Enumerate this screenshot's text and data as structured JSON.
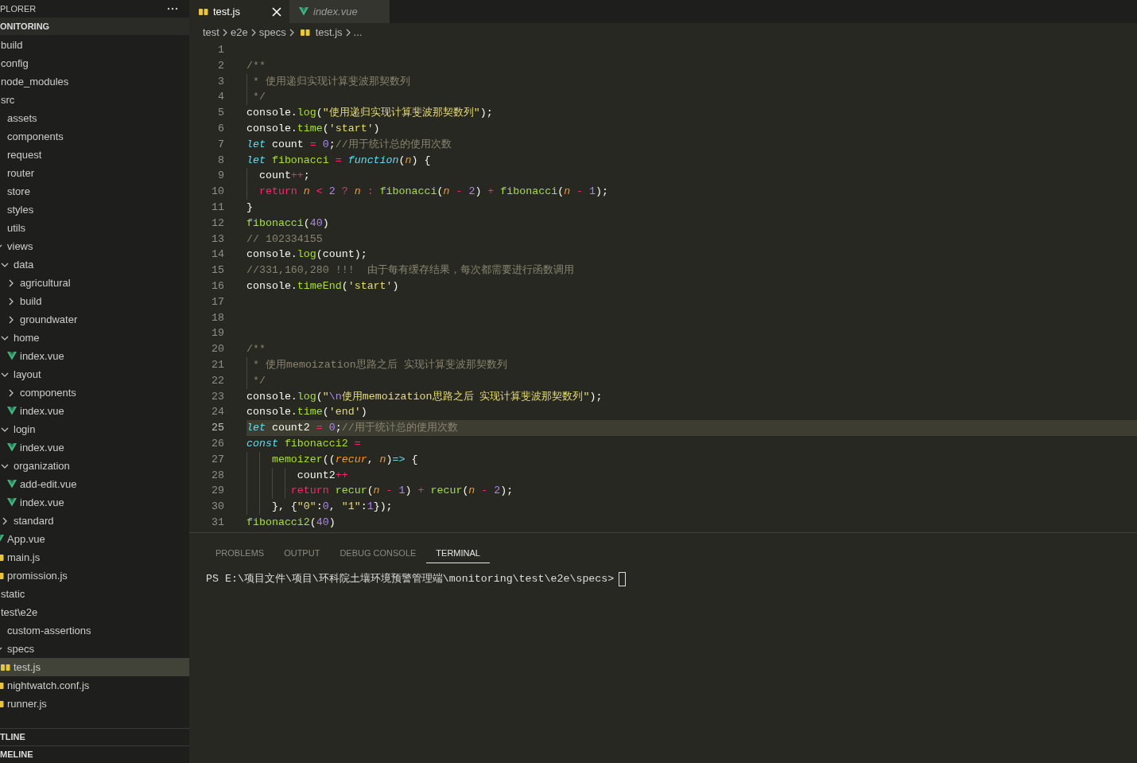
{
  "sidebar": {
    "title": "PLORER",
    "section": "ONITORING",
    "tree": [
      {
        "label": "build",
        "selected": false
      },
      {
        "label": "config",
        "selected": false
      },
      {
        "label": "node_modules",
        "selected": false
      },
      {
        "label": "src",
        "selected": false,
        "children": [
          {
            "label": "assets",
            "selected": false
          },
          {
            "label": "components",
            "selected": false
          },
          {
            "label": "request",
            "selected": false
          },
          {
            "label": "router",
            "selected": false
          },
          {
            "label": "store",
            "selected": false
          },
          {
            "label": "styles",
            "selected": false
          },
          {
            "label": "utils",
            "selected": false
          },
          {
            "label": "views",
            "selected": false,
            "expanded": true,
            "children": [
              {
                "label": "data",
                "selected": false,
                "expanded": true,
                "children": [
                  {
                    "label": "agricultural",
                    "selected": false,
                    "expanded": false
                  },
                  {
                    "label": "build",
                    "selected": false,
                    "expanded": false
                  },
                  {
                    "label": "groundwater",
                    "selected": false,
                    "expanded": false
                  }
                ]
              },
              {
                "label": "home",
                "selected": false,
                "expanded": true,
                "children": [
                  {
                    "label": "index.vue",
                    "kind": "vue",
                    "selected": false
                  }
                ]
              },
              {
                "label": "layout",
                "selected": false,
                "expanded": true,
                "children": [
                  {
                    "label": "components",
                    "selected": false,
                    "expanded": false
                  },
                  {
                    "label": "index.vue",
                    "kind": "vue",
                    "selected": false
                  }
                ]
              },
              {
                "label": "login",
                "selected": false,
                "expanded": true,
                "children": [
                  {
                    "label": "index.vue",
                    "kind": "vue",
                    "selected": false
                  }
                ]
              },
              {
                "label": "organization",
                "selected": false,
                "expanded": true,
                "children": [
                  {
                    "label": "add-edit.vue",
                    "kind": "vue",
                    "selected": false
                  },
                  {
                    "label": "index.vue",
                    "kind": "vue",
                    "selected": false
                  }
                ]
              },
              {
                "label": "standard",
                "selected": false,
                "expanded": false
              }
            ]
          },
          {
            "label": "App.vue",
            "kind": "vue",
            "selected": false
          },
          {
            "label": "main.js",
            "kind": "js",
            "selected": false
          },
          {
            "label": "promission.js",
            "kind": "js",
            "selected": false
          }
        ]
      },
      {
        "label": "static",
        "selected": false
      },
      {
        "label": "test\\e2e",
        "selected": false,
        "children": [
          {
            "label": "custom-assertions",
            "selected": false
          },
          {
            "label": "specs",
            "selected": false,
            "expanded": true,
            "children": [
              {
                "label": "test.js",
                "kind": "js",
                "selected": true
              }
            ]
          },
          {
            "label": "nightwatch.conf.js",
            "kind": "js",
            "selected": false
          },
          {
            "label": "runner.js",
            "kind": "js",
            "selected": false
          }
        ]
      }
    ],
    "bottom_sections": [
      "TLINE",
      "MELINE"
    ]
  },
  "tabs": [
    {
      "label": "test.js",
      "kind": "js",
      "selected": true,
      "preview": false
    },
    {
      "label": "index.vue",
      "kind": "vue",
      "selected": false,
      "preview": true
    }
  ],
  "breadcrumb": [
    {
      "label": "test"
    },
    {
      "label": "e2e"
    },
    {
      "label": "specs"
    },
    {
      "label": "test.js",
      "kind": "js"
    },
    {
      "label": "..."
    }
  ],
  "code_lines": [
    {
      "number": "1",
      "current": false
    },
    {
      "number": "2",
      "current": false,
      "tokens": [
        {
          "kind": "comment",
          "text": "/**"
        }
      ]
    },
    {
      "number": "3",
      "current": false,
      "tokens": [
        {
          "kind": "comment",
          "text": " * 使用递归实现计算斐波那契数列"
        }
      ]
    },
    {
      "number": "4",
      "current": false,
      "tokens": [
        {
          "kind": "comment",
          "text": " */"
        }
      ]
    },
    {
      "number": "5",
      "current": false,
      "tokens": [
        {
          "kind": "plain",
          "text": "console."
        },
        {
          "kind": "func",
          "text": "log"
        },
        {
          "kind": "plain",
          "text": "("
        },
        {
          "kind": "string",
          "text": "\"使用递归实现计算斐波那契数列\""
        },
        {
          "kind": "plain",
          "text": ");"
        }
      ]
    },
    {
      "number": "6",
      "current": false,
      "tokens": [
        {
          "kind": "plain",
          "text": "console."
        },
        {
          "kind": "func",
          "text": "time"
        },
        {
          "kind": "plain",
          "text": "("
        },
        {
          "kind": "string",
          "text": "'start'"
        },
        {
          "kind": "plain",
          "text": ")"
        }
      ]
    },
    {
      "number": "7",
      "current": false,
      "tokens": [
        {
          "kind": "storage",
          "text": "let"
        },
        {
          "kind": "plain",
          "text": " count "
        },
        {
          "kind": "op",
          "text": "= "
        },
        {
          "kind": "number",
          "text": "0"
        },
        {
          "kind": "plain",
          "text": ";"
        },
        {
          "kind": "comment",
          "text": "//用于统计总的使用次数"
        }
      ]
    },
    {
      "number": "8",
      "current": false,
      "tokens": [
        {
          "kind": "storage",
          "text": "let "
        },
        {
          "kind": "func",
          "text": "fibonacci "
        },
        {
          "kind": "op",
          "text": "= "
        },
        {
          "kind": "storage",
          "text": "function"
        },
        {
          "kind": "plain",
          "text": "("
        },
        {
          "kind": "param",
          "text": "n"
        },
        {
          "kind": "plain",
          "text": ") {"
        }
      ]
    },
    {
      "number": "9",
      "current": false,
      "tokens": [
        {
          "kind": "plain",
          "text": "  count"
        },
        {
          "kind": "op",
          "text": "++"
        },
        {
          "kind": "plain",
          "text": ";"
        }
      ]
    },
    {
      "number": "10",
      "current": false,
      "tokens": [
        {
          "kind": "keyword",
          "text": "  return "
        },
        {
          "kind": "param",
          "text": "n "
        },
        {
          "kind": "op",
          "text": "< "
        },
        {
          "kind": "number",
          "text": "2 "
        },
        {
          "kind": "op",
          "text": "? "
        },
        {
          "kind": "param",
          "text": "n "
        },
        {
          "kind": "op",
          "text": ": "
        },
        {
          "kind": "func",
          "text": "fibonacci"
        },
        {
          "kind": "plain",
          "text": "("
        },
        {
          "kind": "param",
          "text": "n "
        },
        {
          "kind": "op",
          "text": "- "
        },
        {
          "kind": "number",
          "text": "2"
        },
        {
          "kind": "plain",
          "text": ") "
        },
        {
          "kind": "op",
          "text": "+ "
        },
        {
          "kind": "func",
          "text": "fibonacci"
        },
        {
          "kind": "plain",
          "text": "("
        },
        {
          "kind": "param",
          "text": "n "
        },
        {
          "kind": "op",
          "text": "- "
        },
        {
          "kind": "number",
          "text": "1"
        },
        {
          "kind": "plain",
          "text": ");"
        }
      ]
    },
    {
      "number": "11",
      "current": false,
      "tokens": [
        {
          "kind": "plain",
          "text": "}"
        }
      ]
    },
    {
      "number": "12",
      "current": false,
      "tokens": [
        {
          "kind": "func",
          "text": "fibonacci"
        },
        {
          "kind": "plain",
          "text": "("
        },
        {
          "kind": "number",
          "text": "40"
        },
        {
          "kind": "plain",
          "text": ")"
        }
      ]
    },
    {
      "number": "13",
      "current": false,
      "tokens": [
        {
          "kind": "comment",
          "text": "// 102334155"
        }
      ]
    },
    {
      "number": "14",
      "current": false,
      "tokens": [
        {
          "kind": "plain",
          "text": "console."
        },
        {
          "kind": "func",
          "text": "log"
        },
        {
          "kind": "plain",
          "text": "(count);"
        }
      ]
    },
    {
      "number": "15",
      "current": false,
      "tokens": [
        {
          "kind": "comment",
          "text": "//331,160,280 !!!  由于每有缓存结果，每次都需要进行函数调用"
        }
      ]
    },
    {
      "number": "16",
      "current": false,
      "tokens": [
        {
          "kind": "plain",
          "text": "console."
        },
        {
          "kind": "func",
          "text": "timeEnd"
        },
        {
          "kind": "plain",
          "text": "("
        },
        {
          "kind": "string",
          "text": "'start'"
        },
        {
          "kind": "plain",
          "text": ")"
        }
      ]
    },
    {
      "number": "17",
      "current": false
    },
    {
      "number": "18",
      "current": false
    },
    {
      "number": "19",
      "current": false
    },
    {
      "number": "20",
      "current": false,
      "tokens": [
        {
          "kind": "comment",
          "text": "/**"
        }
      ]
    },
    {
      "number": "21",
      "current": false,
      "tokens": [
        {
          "kind": "comment",
          "text": " * 使用memoization思路之后 实现计算斐波那契数列"
        }
      ]
    },
    {
      "number": "22",
      "current": false,
      "tokens": [
        {
          "kind": "comment",
          "text": " */"
        }
      ]
    },
    {
      "number": "23",
      "current": false,
      "tokens": [
        {
          "kind": "plain",
          "text": "console."
        },
        {
          "kind": "func",
          "text": "log"
        },
        {
          "kind": "plain",
          "text": "("
        },
        {
          "kind": "string",
          "text": "\""
        },
        {
          "kind": "number",
          "text": "\\n"
        },
        {
          "kind": "string",
          "text": "使用memoization思路之后 实现计算斐波那契数列\""
        },
        {
          "kind": "plain",
          "text": ");"
        }
      ]
    },
    {
      "number": "24",
      "current": false,
      "tokens": [
        {
          "kind": "plain",
          "text": "console."
        },
        {
          "kind": "func",
          "text": "time"
        },
        {
          "kind": "plain",
          "text": "("
        },
        {
          "kind": "string",
          "text": "'end'"
        },
        {
          "kind": "plain",
          "text": ")"
        }
      ]
    },
    {
      "number": "25",
      "current": true,
      "tokens": [
        {
          "kind": "storage",
          "text": "let"
        },
        {
          "kind": "plain",
          "text": " count2 "
        },
        {
          "kind": "op",
          "text": "= "
        },
        {
          "kind": "number",
          "text": "0"
        },
        {
          "kind": "plain",
          "text": ";"
        },
        {
          "kind": "comment",
          "text": "//用于统计总的使用次数"
        }
      ]
    },
    {
      "number": "26",
      "current": false,
      "tokens": [
        {
          "kind": "storage",
          "text": "const "
        },
        {
          "kind": "func",
          "text": "fibonacci2 "
        },
        {
          "kind": "op",
          "text": "="
        }
      ]
    },
    {
      "number": "27",
      "current": false,
      "tokens": [
        {
          "kind": "func",
          "text": "    memoizer"
        },
        {
          "kind": "plain",
          "text": "(("
        },
        {
          "kind": "param",
          "text": "recur"
        },
        {
          "kind": "plain",
          "text": ", "
        },
        {
          "kind": "param",
          "text": "n"
        },
        {
          "kind": "plain",
          "text": ")"
        },
        {
          "kind": "storage",
          "text": "=>"
        },
        {
          "kind": "plain",
          "text": " {"
        }
      ]
    },
    {
      "number": "28",
      "current": false,
      "tokens": [
        {
          "kind": "plain",
          "text": "        count2"
        },
        {
          "kind": "op",
          "text": "++"
        }
      ]
    },
    {
      "number": "29",
      "current": false,
      "tokens": [
        {
          "kind": "keyword",
          "text": "       return "
        },
        {
          "kind": "func",
          "text": "recur"
        },
        {
          "kind": "plain",
          "text": "("
        },
        {
          "kind": "param",
          "text": "n "
        },
        {
          "kind": "op",
          "text": "- "
        },
        {
          "kind": "number",
          "text": "1"
        },
        {
          "kind": "plain",
          "text": ") "
        },
        {
          "kind": "op",
          "text": "+ "
        },
        {
          "kind": "func",
          "text": "recur"
        },
        {
          "kind": "plain",
          "text": "("
        },
        {
          "kind": "param",
          "text": "n "
        },
        {
          "kind": "op",
          "text": "- "
        },
        {
          "kind": "number",
          "text": "2"
        },
        {
          "kind": "plain",
          "text": ");"
        }
      ]
    },
    {
      "number": "30",
      "current": false,
      "tokens": [
        {
          "kind": "plain",
          "text": "    }, {"
        },
        {
          "kind": "string",
          "text": "\"0\""
        },
        {
          "kind": "plain",
          "text": ":"
        },
        {
          "kind": "number",
          "text": "0"
        },
        {
          "kind": "plain",
          "text": ", "
        },
        {
          "kind": "string",
          "text": "\"1\""
        },
        {
          "kind": "plain",
          "text": ":"
        },
        {
          "kind": "number",
          "text": "1"
        },
        {
          "kind": "plain",
          "text": "});"
        }
      ]
    },
    {
      "number": "31",
      "current": false,
      "tokens": [
        {
          "kind": "func",
          "text": "fibonacci2"
        },
        {
          "kind": "plain",
          "text": "("
        },
        {
          "kind": "number",
          "text": "40"
        },
        {
          "kind": "plain",
          "text": ")"
        }
      ]
    }
  ],
  "panel": {
    "tabs": [
      {
        "label": "PROBLEMS",
        "selected": false
      },
      {
        "label": "OUTPUT",
        "selected": false
      },
      {
        "label": "DEBUG CONSOLE",
        "selected": false
      },
      {
        "label": "TERMINAL",
        "selected": true
      }
    ],
    "terminal_prompt": "PS E:\\项目文件\\项目\\环科院土壤环境预警管理端\\monitoring\\test\\e2e\\specs>"
  }
}
